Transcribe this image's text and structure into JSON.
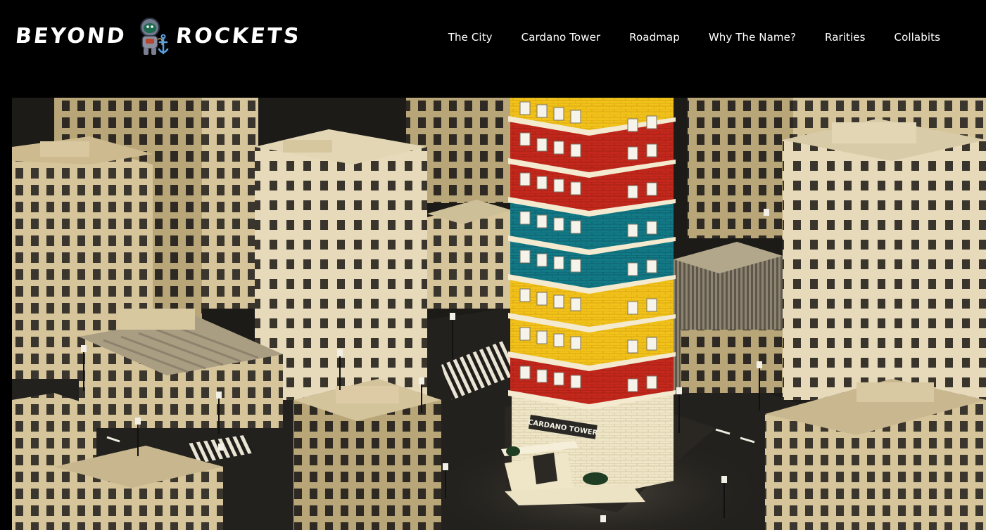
{
  "brand": {
    "name_left": "BEYOND",
    "name_right": "ROCKETS",
    "mascot_icon": "astronaut-anchor-icon"
  },
  "nav": {
    "items": [
      {
        "label": "The City"
      },
      {
        "label": "Cardano Tower"
      },
      {
        "label": "Roadmap"
      },
      {
        "label": "Why The Name?"
      },
      {
        "label": "Rarities"
      },
      {
        "label": "Collabits"
      }
    ]
  },
  "hero": {
    "tower_sign": "CARDANO TOWER"
  },
  "colors": {
    "background": "#000000",
    "nav_text": "#ffffff",
    "building_beige": "#d9c9a3",
    "tower_red": "#c4281c",
    "tower_yellow": "#f2c21b",
    "tower_teal": "#127a86",
    "tower_cream": "#efe6c8"
  }
}
